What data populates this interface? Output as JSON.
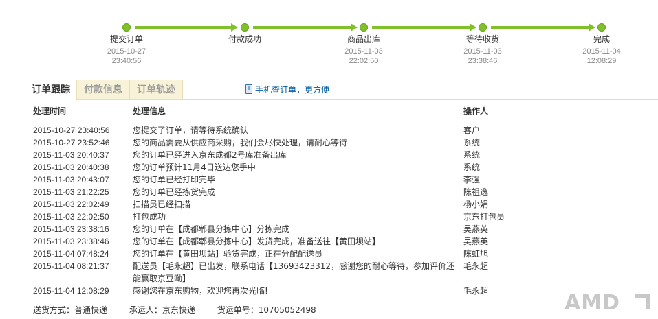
{
  "progress": {
    "steps": [
      {
        "label": "提交订单",
        "date": "2015-10-27",
        "time": "23:40:56"
      },
      {
        "label": "付款成功",
        "date": "",
        "time": ""
      },
      {
        "label": "商品出库",
        "date": "2015-11-03",
        "time": "22:02:50"
      },
      {
        "label": "等待收货",
        "date": "2015-11-03",
        "time": "23:38:46"
      },
      {
        "label": "完成",
        "date": "2015-11-04",
        "time": "12:08:29"
      }
    ]
  },
  "tabs": [
    "订单跟踪",
    "付款信息",
    "订单轨迹"
  ],
  "mobile_link": "手机查订单，更方便",
  "table": {
    "headers": [
      "处理时间",
      "处理信息",
      "操作人"
    ],
    "rows": [
      {
        "time": "2015-10-27 23:40:56",
        "info": "您提交了订单，请等待系统确认",
        "op": "客户"
      },
      {
        "time": "2015-10-27 23:52:46",
        "info": "您的商品需要从供应商采购，我们会尽快处理，请耐心等待",
        "op": "系统"
      },
      {
        "time": "2015-11-03 20:40:37",
        "info": "您的订单已经进入京东成都2号库准备出库",
        "op": "系统"
      },
      {
        "time": "2015-11-03 20:40:38",
        "info": "您的订单预计11月4日送达您手中",
        "op": "系统"
      },
      {
        "time": "2015-11-03 20:43:07",
        "info": "您的订单已经打印完毕",
        "op": "李强"
      },
      {
        "time": "2015-11-03 21:22:25",
        "info": "您的订单已经拣货完成",
        "op": "陈祖逸"
      },
      {
        "time": "2015-11-03 22:02:49",
        "info": "扫描员已经扫描",
        "op": "杨小娟"
      },
      {
        "time": "2015-11-03 22:02:50",
        "info": "打包成功",
        "op": "京东打包员"
      },
      {
        "time": "2015-11-03 23:38:16",
        "info": "您的订单在【成都郫县分拣中心】分拣完成",
        "op": "吴燕英"
      },
      {
        "time": "2015-11-03 23:38:46",
        "info": "您的订单在【成都郫县分拣中心】发货完成，准备送往【黄田坝站】",
        "op": "吴燕英"
      },
      {
        "time": "2015-11-04 07:48:24",
        "info": "您的订单在【黄田坝站】验货完成，正在分配配送员",
        "op": "陈虹旭"
      },
      {
        "time": "2015-11-04 08:21:37",
        "info": "配送员【毛永超】已出发，联系电话【13693423312，感谢您的耐心等待，参加评价还能赢取京豆呦】",
        "op": "毛永超"
      },
      {
        "time": "2015-11-04 12:08:29",
        "info": "感谢您在京东购物，欢迎您再次光临!",
        "op": "毛永超"
      }
    ]
  },
  "footer": {
    "shipping": "送货方式：普通快递",
    "carrier": "承运人：京东快递",
    "tracking": "货运单号：10705052498"
  },
  "watermark": "AMD",
  "colors": {
    "progress": "#80c12b",
    "link": "#005aa0",
    "tab_inactive_bg": "#f7f2d8"
  }
}
